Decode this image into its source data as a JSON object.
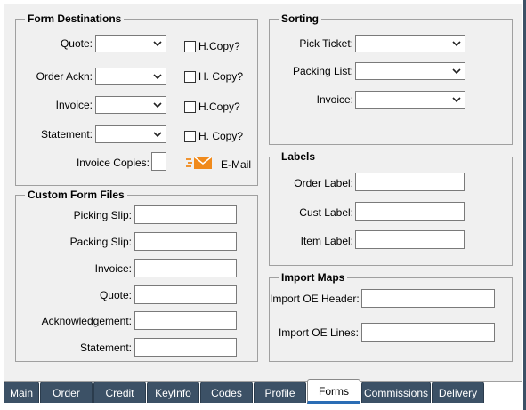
{
  "form_destinations": {
    "title": "Form Destinations",
    "rows": [
      {
        "label": "Quote:",
        "copy_label": "H.Copy?"
      },
      {
        "label": "Order Ackn:",
        "copy_label": "H. Copy?"
      },
      {
        "label": "Invoice:",
        "copy_label": "H.Copy?"
      },
      {
        "label": "Statement:",
        "copy_label": "H. Copy?"
      }
    ],
    "invoice_copies_label": "Invoice Copies:",
    "email_label": "E-Mail"
  },
  "sorting": {
    "title": "Sorting",
    "rows": [
      {
        "label": "Pick Ticket:"
      },
      {
        "label": "Packing List:"
      },
      {
        "label": "Invoice:"
      }
    ]
  },
  "labels": {
    "title": "Labels",
    "rows": [
      {
        "label": "Order Label:"
      },
      {
        "label": "Cust Label:"
      },
      {
        "label": "Item Label:"
      }
    ]
  },
  "custom_form_files": {
    "title": "Custom Form Files",
    "rows": [
      {
        "label": "Picking Slip:"
      },
      {
        "label": "Packing Slip:"
      },
      {
        "label": "Invoice:"
      },
      {
        "label": "Quote:"
      },
      {
        "label": "Acknowledgement:"
      },
      {
        "label": "Statement:"
      }
    ]
  },
  "import_maps": {
    "title": "Import Maps",
    "rows": [
      {
        "label": "Import OE Header:"
      },
      {
        "label": "Import OE Lines:"
      }
    ]
  },
  "tabs": [
    {
      "label": "Main"
    },
    {
      "label": "Order"
    },
    {
      "label": "Credit"
    },
    {
      "label": "KeyInfo"
    },
    {
      "label": "Codes"
    },
    {
      "label": "Profile"
    },
    {
      "label": "Forms",
      "active": true
    },
    {
      "label": "Commissions"
    },
    {
      "label": "Delivery"
    }
  ],
  "icons": {
    "email": "email-envelope-icon",
    "dropdown": "chevron-down-icon"
  },
  "colors": {
    "tab_bg": "#3c5166",
    "tab_active_underline": "#2a6db5",
    "email_icon": "#f08a1c"
  }
}
